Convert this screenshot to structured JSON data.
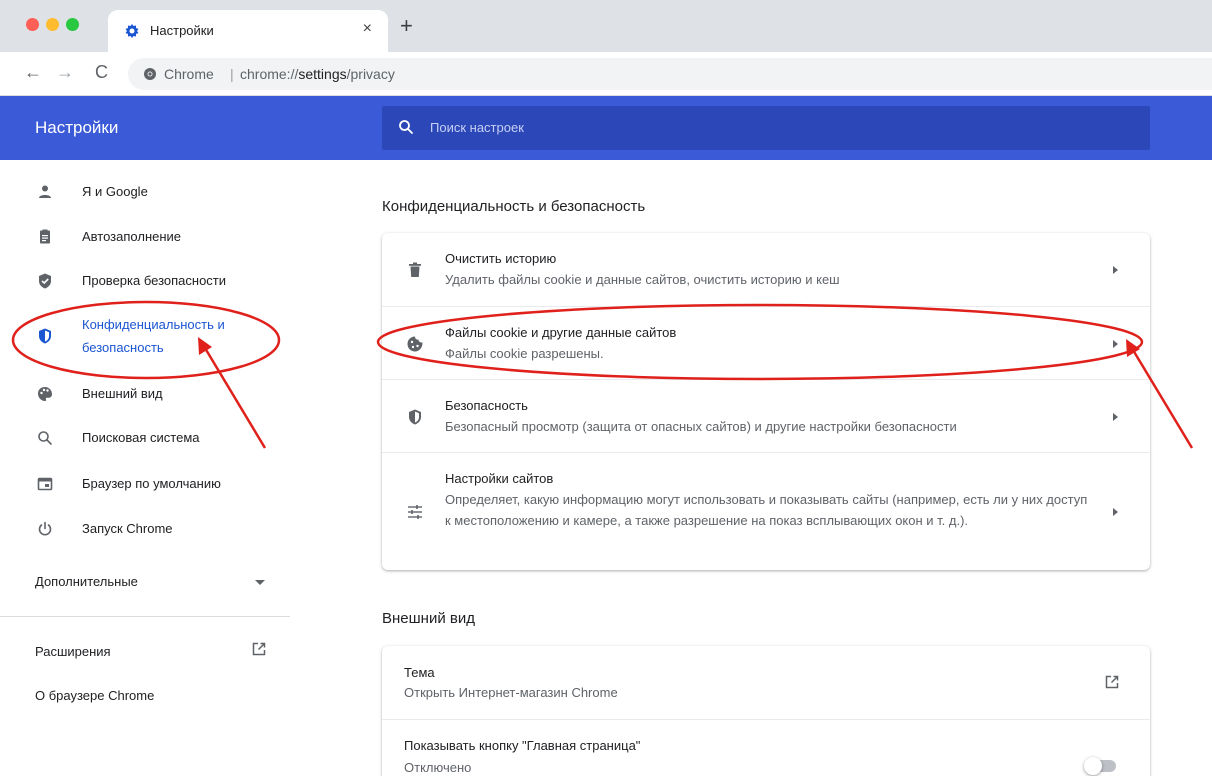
{
  "browser": {
    "tab_title": "Настройки",
    "tab_close": "×",
    "new_tab": "+",
    "back": "←",
    "forward": "→",
    "reload": "C",
    "omnibox_site": "Chrome",
    "omnibox_sep": "|",
    "url_prefix": "chrome://",
    "url_host": "settings",
    "url_path": "/privacy"
  },
  "header": {
    "title": "Настройки",
    "search_placeholder": "Поиск настроек",
    "color": "#3b5ad7"
  },
  "sidebar": {
    "items": [
      {
        "label": "Я и Google",
        "icon": "person-icon"
      },
      {
        "label": "Автозаполнение",
        "icon": "clipboard-icon"
      },
      {
        "label": "Проверка безопасности",
        "icon": "shield-check-icon"
      },
      {
        "label": "Конфиденциальность и",
        "label2": "безопасность",
        "icon": "shield-privacy-icon",
        "active": true
      },
      {
        "label": "Внешний вид",
        "icon": "palette-icon"
      },
      {
        "label": "Поисковая система",
        "icon": "search-icon"
      },
      {
        "label": "Браузер по умолчанию",
        "icon": "browser-icon"
      },
      {
        "label": "Запуск Chrome",
        "icon": "power-icon"
      }
    ],
    "advanced": "Дополнительные",
    "extensions": "Расширения",
    "about": "О браузере Chrome"
  },
  "privacy_section": {
    "title": "Конфиденциальность и безопасность",
    "rows": [
      {
        "title": "Очистить историю",
        "subtitle": "Удалить файлы cookie и данные сайтов, очистить историю и кеш",
        "icon": "trash-icon"
      },
      {
        "title": "Файлы cookie и другие данные сайтов",
        "subtitle": "Файлы cookie разрешены.",
        "icon": "cookie-icon"
      },
      {
        "title": "Безопасность",
        "subtitle": "Безопасный просмотр (защита от опасных сайтов) и другие настройки безопасности",
        "icon": "shield-icon"
      },
      {
        "title": "Настройки сайтов",
        "subtitle": "Определяет, какую информацию могут использовать и показывать сайты (например, есть ли у них доступ к местоположению и камере, а также разрешение на показ всплывающих окон и т. д.).",
        "icon": "tune-icon"
      }
    ]
  },
  "appearance_section": {
    "title": "Внешний вид",
    "theme_title": "Тема",
    "theme_sub": "Открыть Интернет-магазин Chrome",
    "home_title": "Показывать кнопку \"Главная страница\"",
    "home_sub": "Отключено"
  },
  "annotation_color": "#e0201b"
}
